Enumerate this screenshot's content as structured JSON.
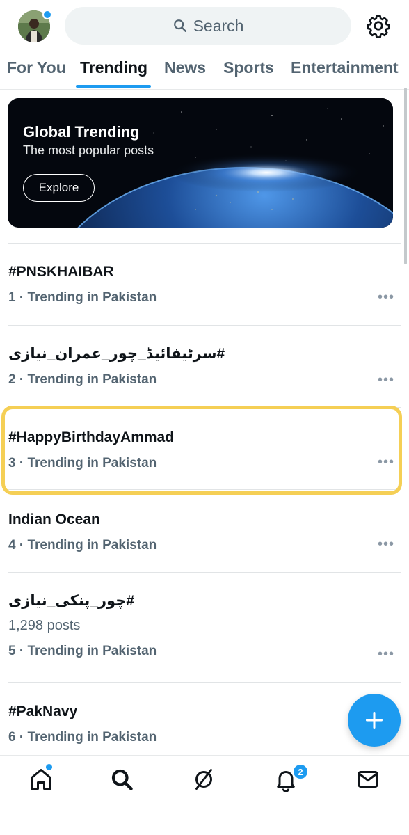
{
  "search": {
    "placeholder": "Search"
  },
  "tabs": [
    {
      "label": "For You"
    },
    {
      "label": "Trending"
    },
    {
      "label": "News"
    },
    {
      "label": "Sports"
    },
    {
      "label": "Entertainment"
    }
  ],
  "banner": {
    "title": "Global Trending",
    "subtitle": "The most popular posts",
    "button": "Explore"
  },
  "trends": [
    {
      "name": "#PNSKHAIBAR",
      "meta": "1 · Trending in Pakistan"
    },
    {
      "name": "#سرٹیفائیڈ_چور_عمران_نیازی",
      "meta": "2 · Trending in Pakistan"
    },
    {
      "name": "#HappyBirthdayAmmad",
      "meta": "3 · Trending in Pakistan"
    },
    {
      "name": "Indian Ocean",
      "meta": "4 · Trending in Pakistan"
    },
    {
      "name": "#چور_پنکی_نیازی",
      "posts": "1,298 posts",
      "meta": "5 · Trending in Pakistan"
    },
    {
      "name": "#PakNavy",
      "meta": "6 · Trending in Pakistan"
    }
  ],
  "more_label": "•••",
  "notifications": {
    "badge": "2"
  },
  "icons": {
    "search": "search-icon",
    "settings": "gear-icon",
    "home": "home-icon",
    "explore": "search-icon",
    "grok": "grok-icon",
    "notifications": "bell-icon",
    "messages": "mail-icon",
    "compose": "plus-icon"
  },
  "colors": {
    "accent": "#1d9bf0",
    "highlight": "#f5cf55",
    "secondary_text": "#536471"
  }
}
